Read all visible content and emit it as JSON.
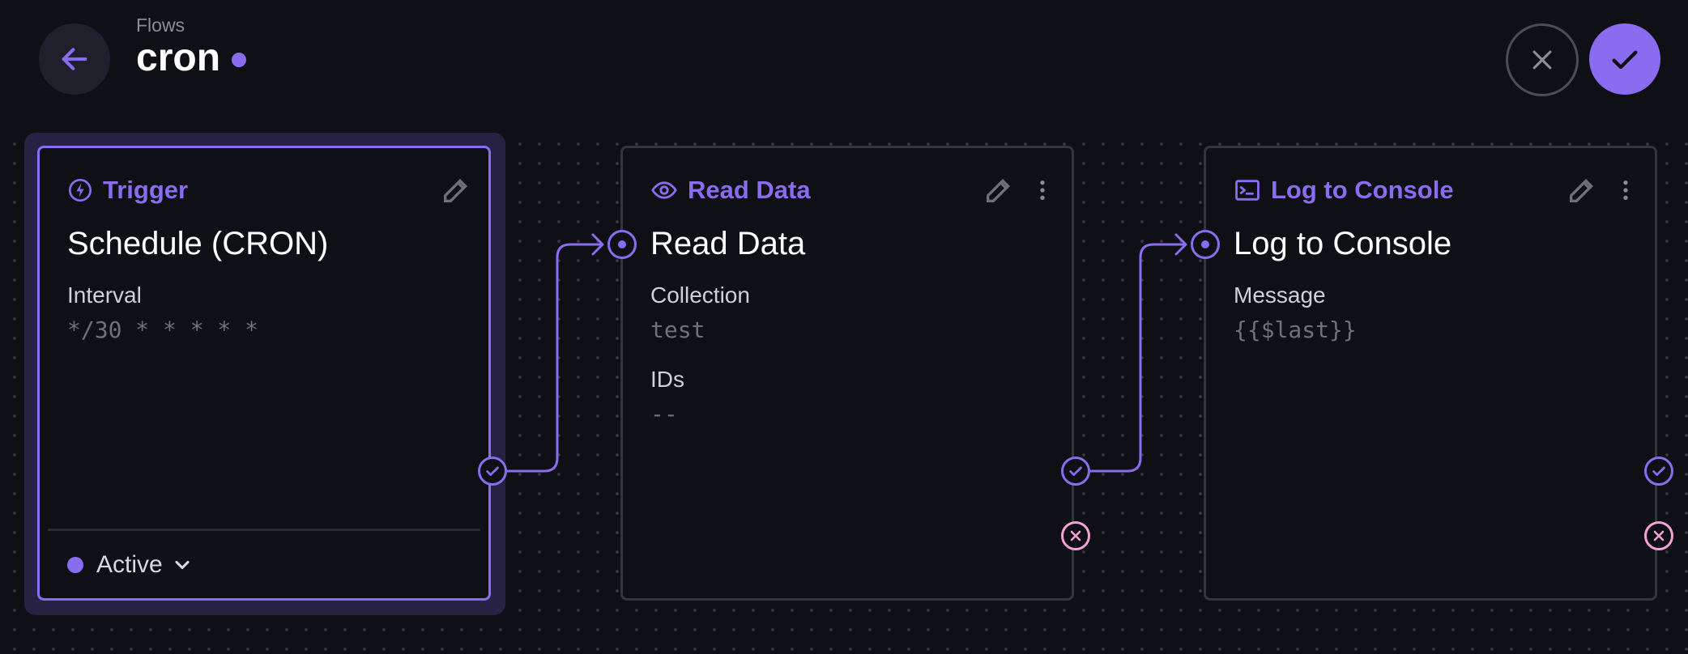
{
  "header": {
    "breadcrumb": "Flows",
    "title": "cron"
  },
  "colors": {
    "accent": "#8a6cf0",
    "error": "#f5a3d6",
    "background": "#0e1015"
  },
  "trigger": {
    "type_label": "Trigger",
    "name": "Schedule (CRON)",
    "field_label": "Interval",
    "field_value": "*/30 * * * * *",
    "status": "Active"
  },
  "operations": [
    {
      "type_label": "Read Data",
      "name": "Read Data",
      "fields": [
        {
          "label": "Collection",
          "value": "test"
        },
        {
          "label": "IDs",
          "value": "--"
        }
      ]
    },
    {
      "type_label": "Log to Console",
      "name": "Log to Console",
      "fields": [
        {
          "label": "Message",
          "value": "{{$last}}"
        }
      ]
    }
  ]
}
